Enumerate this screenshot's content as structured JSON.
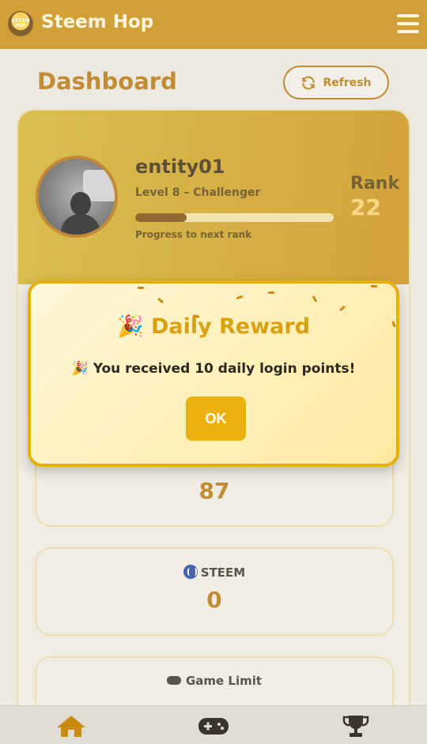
{
  "header": {
    "logo_text": "STEEM HOP",
    "app_title": "Steem Hop"
  },
  "dashboard": {
    "title": "Dashboard",
    "refresh_label": "Refresh"
  },
  "profile": {
    "username": "entity01",
    "level": "Level 8 – Challenger",
    "progress_fraction": 0.26,
    "progress_label": "Progress to next rank",
    "rank_label": "Rank",
    "rank_value": "22"
  },
  "stats": [
    {
      "label": "",
      "value": "87"
    },
    {
      "label": "STEEM",
      "value": "0",
      "icon": "steem-icon"
    },
    {
      "label": "Game Limit",
      "value": "",
      "icon": "gamepad-icon"
    }
  ],
  "modal": {
    "title_emoji": "🎉",
    "title": "Daily Reward",
    "message_emoji": "🎉",
    "message": "You received 10 daily login points!",
    "ok_label": "OK"
  },
  "nav": [
    "home-icon",
    "gamepad-icon",
    "trophy-icon"
  ],
  "colors": {
    "accent": "#c98b0e",
    "title": "#b57309",
    "modal_title": "#d9a010",
    "ok_button": "#ebb20e"
  }
}
